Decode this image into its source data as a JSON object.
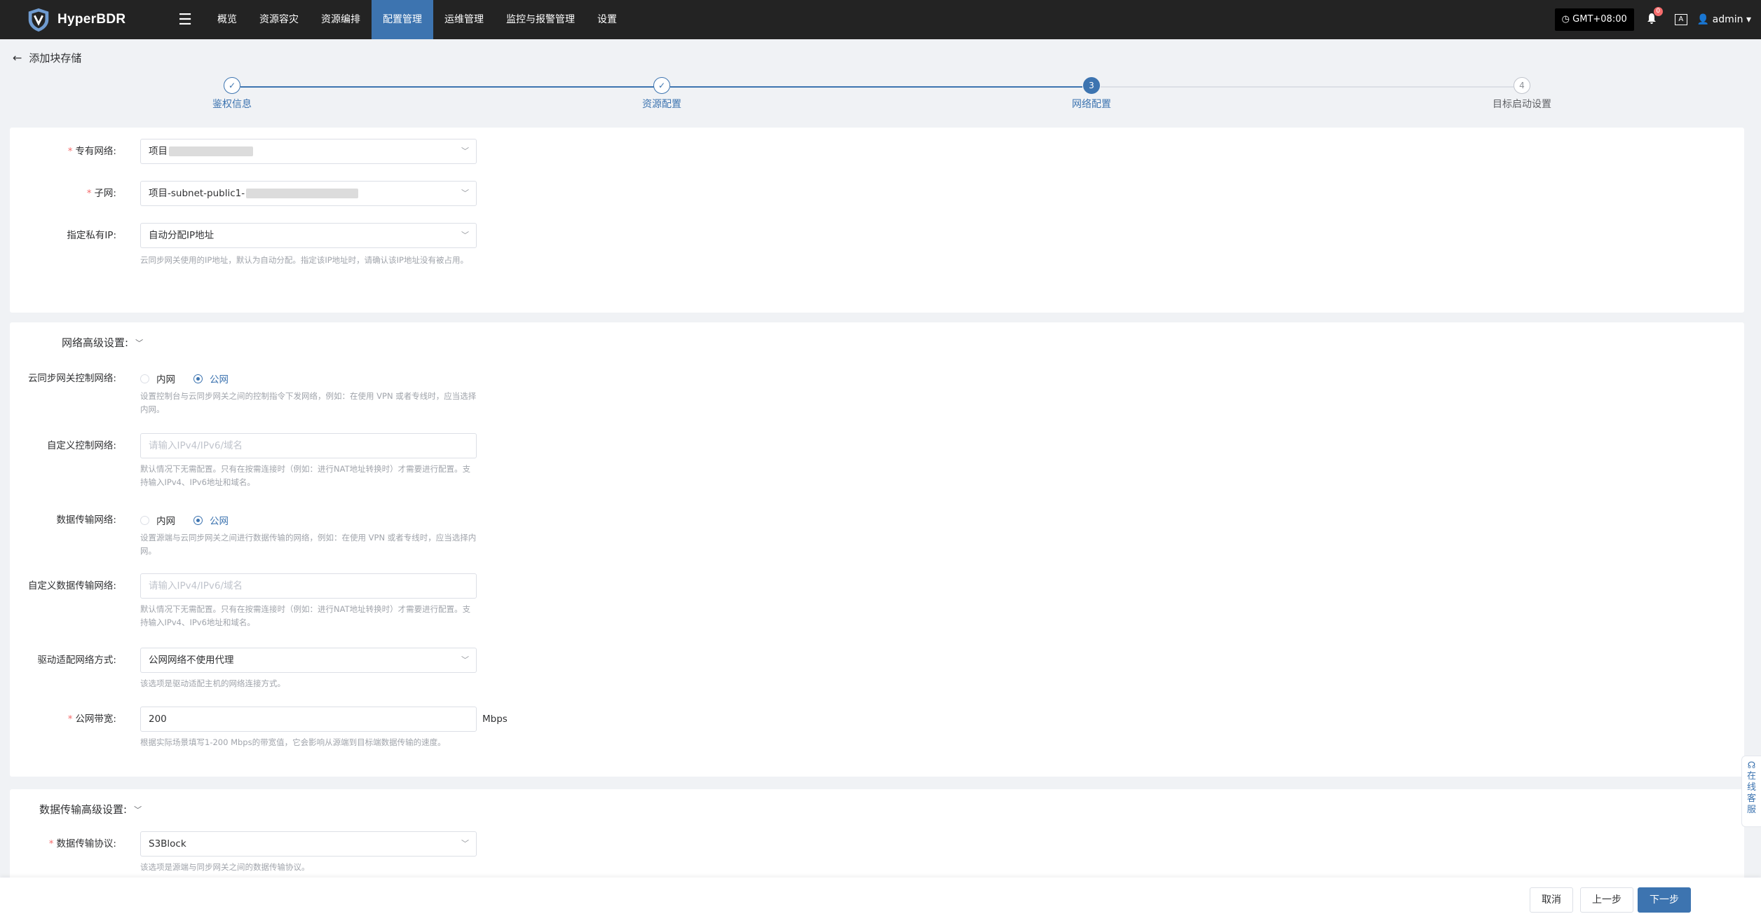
{
  "app": {
    "name": "HyperBDR",
    "menu_icon": "hamburger-icon"
  },
  "nav": [
    {
      "label": "概览",
      "active": false
    },
    {
      "label": "资源容灾",
      "active": false
    },
    {
      "label": "资源编排",
      "active": false
    },
    {
      "label": "配置管理",
      "active": true
    },
    {
      "label": "运维管理",
      "active": false
    },
    {
      "label": "监控与报警管理",
      "active": false
    },
    {
      "label": "设置",
      "active": false
    }
  ],
  "topright": {
    "timezone": "GMT+08:00",
    "notifications": "0",
    "lang": "A",
    "user": "admin"
  },
  "page": {
    "title": "添加块存储"
  },
  "steps": [
    {
      "label": "鉴权信息",
      "state": "done",
      "num": "✓"
    },
    {
      "label": "资源配置",
      "state": "done",
      "num": "✓"
    },
    {
      "label": "网络配置",
      "state": "current",
      "num": "3"
    },
    {
      "label": "目标启动设置",
      "state": "todo",
      "num": "4"
    }
  ],
  "network": {
    "vpc": {
      "label": "专有网络:",
      "value": "项目"
    },
    "subnet": {
      "label": "子网:",
      "value": "项目-subnet-public1-"
    },
    "private_ip": {
      "label": "指定私有IP:",
      "value": "自动分配IP地址",
      "help": "云同步网关使用的IP地址，默认为自动分配。指定该IP地址时，请确认该IP地址没有被占用。"
    }
  },
  "advanced": {
    "title": "网络高级设置:",
    "control_net": {
      "label": "云同步网关控制网络:",
      "options": [
        "内网",
        "公网"
      ],
      "selected": "公网",
      "help": "设置控制台与云同步网关之间的控制指令下发网络，例如：在使用 VPN 或者专线时，应当选择内网。"
    },
    "custom_control": {
      "label": "自定义控制网络:",
      "placeholder": "请输入IPv4/IPv6/域名",
      "help": "默认情况下无需配置。只有在按需连接时（例如：进行NAT地址转换时）才需要进行配置。支持输入IPv4、IPv6地址和域名。"
    },
    "data_net": {
      "label": "数据传输网络:",
      "options": [
        "内网",
        "公网"
      ],
      "selected": "公网",
      "help": "设置源端与云同步网关之间进行数据传输的网络，例如：在使用 VPN 或者专线时，应当选择内网。"
    },
    "custom_data": {
      "label": "自定义数据传输网络:",
      "placeholder": "请输入IPv4/IPv6/域名",
      "help": "默认情况下无需配置。只有在按需连接时（例如：进行NAT地址转换时）才需要进行配置。支持输入IPv4、IPv6地址和域名。"
    },
    "driver_mode": {
      "label": "驱动适配网络方式:",
      "value": "公网网络不使用代理",
      "help": "该选项是驱动适配主机的网络连接方式。"
    },
    "bandwidth": {
      "label": "公网带宽:",
      "value": "200",
      "unit": "Mbps",
      "help": "根据实际场景填写1-200 Mbps的带宽值，它会影响从源端到目标端数据传输的速度。"
    }
  },
  "transfer": {
    "title": "数据传输高级设置:",
    "protocol": {
      "label": "数据传输协议:",
      "value": "S3Block",
      "help": "该选项是源端与同步网关之间的数据传输协议。"
    }
  },
  "footer": {
    "cancel": "取消",
    "prev": "上一步",
    "next": "下一步"
  },
  "service": {
    "text": [
      "在",
      "线",
      "客",
      "服"
    ]
  },
  "colors": {
    "primary": "#3d74b0",
    "topbar": "#232323",
    "danger": "#f56c6c"
  }
}
